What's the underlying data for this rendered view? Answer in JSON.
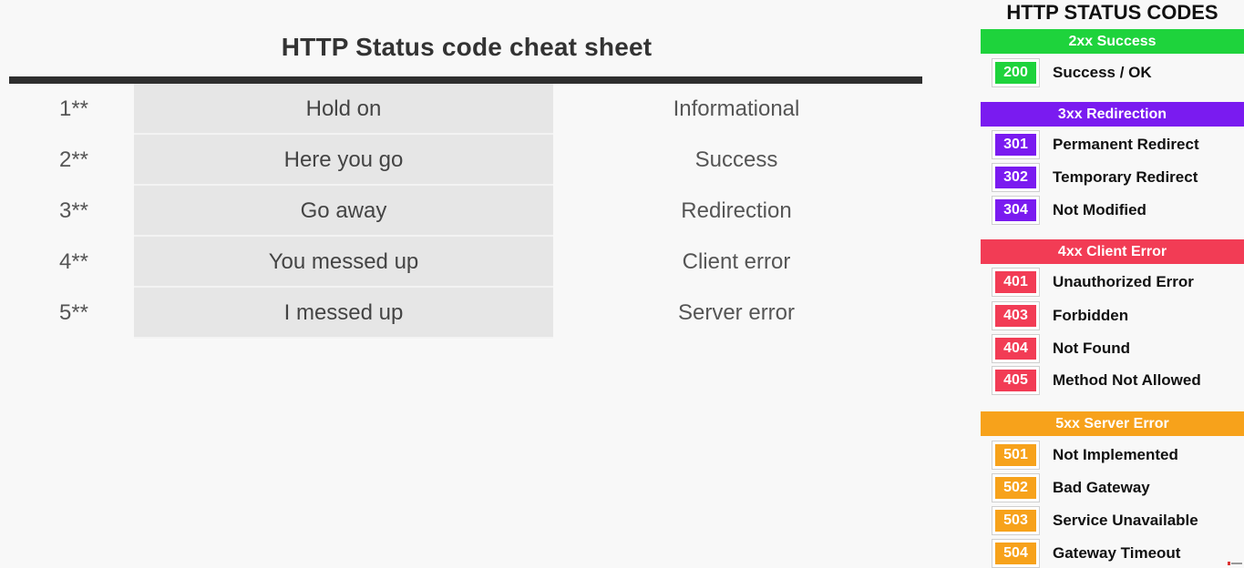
{
  "sheet": {
    "title": "HTTP Status code cheat sheet",
    "rows": [
      {
        "code": "1**",
        "message": "Hold on",
        "category": "Informational"
      },
      {
        "code": "2**",
        "message": "Here you go",
        "category": "Success"
      },
      {
        "code": "3**",
        "message": "Go away",
        "category": "Redirection"
      },
      {
        "code": "4**",
        "message": "You messed up",
        "category": "Client error"
      },
      {
        "code": "5**",
        "message": "I messed up",
        "category": "Server error"
      }
    ]
  },
  "codes_panel": {
    "title": "HTTP STATUS CODES",
    "groups": [
      {
        "label": "2xx Success",
        "color": "#1ed33c",
        "codes": [
          {
            "code": "200",
            "text": "Success / OK"
          }
        ]
      },
      {
        "label": "3xx Redirection",
        "color": "#7a1bf0",
        "codes": [
          {
            "code": "301",
            "text": "Permanent Redirect"
          },
          {
            "code": "302",
            "text": "Temporary Redirect"
          },
          {
            "code": "304",
            "text": "Not Modified"
          }
        ]
      },
      {
        "label": "4xx Client Error",
        "color": "#f23c55",
        "codes": [
          {
            "code": "401",
            "text": "Unauthorized Error"
          },
          {
            "code": "403",
            "text": "Forbidden"
          },
          {
            "code": "404",
            "text": "Not Found"
          },
          {
            "code": "405",
            "text": "Method Not Allowed"
          }
        ]
      },
      {
        "label": "5xx Server Error",
        "color": "#f7a21b",
        "codes": [
          {
            "code": "501",
            "text": "Not Implemented"
          },
          {
            "code": "502",
            "text": "Bad Gateway"
          },
          {
            "code": "503",
            "text": "Service Unavailable"
          },
          {
            "code": "504",
            "text": "Gateway Timeout"
          }
        ]
      }
    ]
  }
}
